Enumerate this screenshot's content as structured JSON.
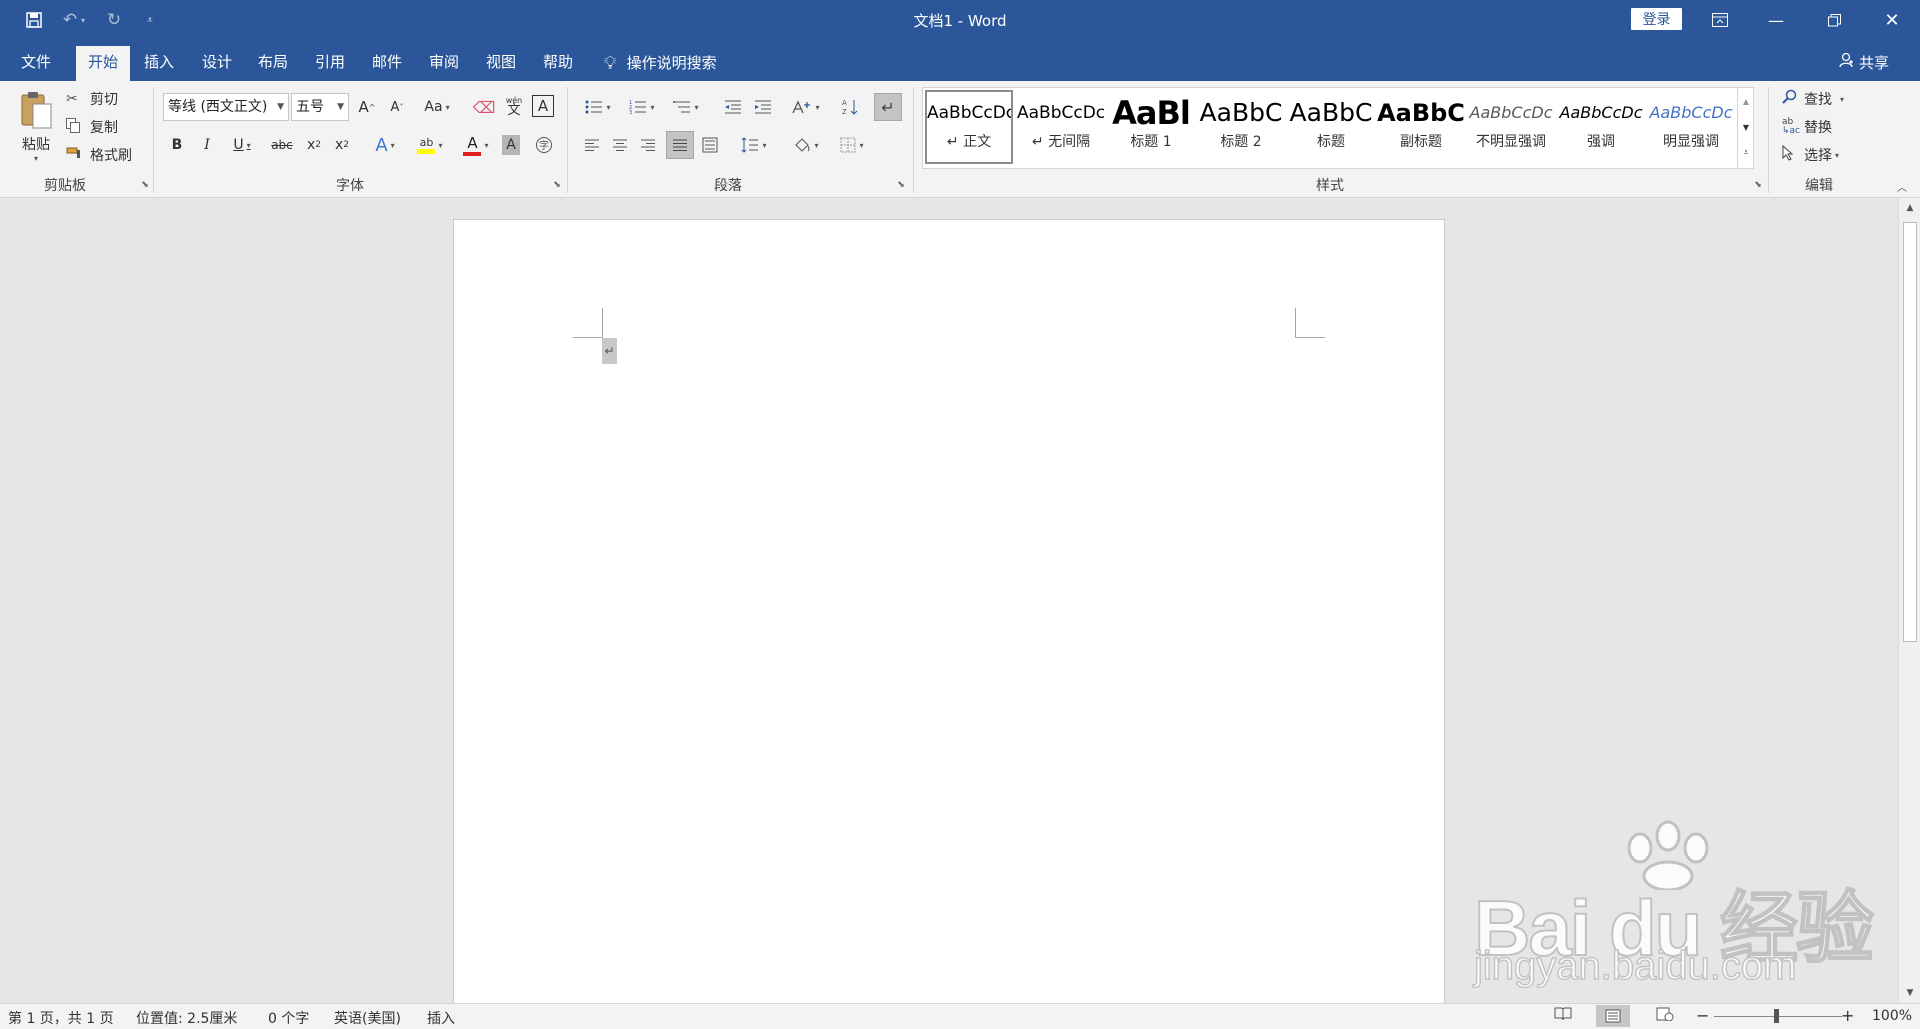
{
  "titlebar": {
    "doc_title": "文档1  -  Word",
    "login_label": "登录",
    "quick_access": [
      "save-icon",
      "undo-icon",
      "redo-icon",
      "customize-icon"
    ]
  },
  "tabs": [
    "文件",
    "开始",
    "插入",
    "设计",
    "布局",
    "引用",
    "邮件",
    "审阅",
    "视图",
    "帮助"
  ],
  "active_tab": "开始",
  "tell_me": "操作说明搜索",
  "share_label": "共享",
  "clipboard": {
    "paste_label": "粘贴",
    "cut_label": "剪切",
    "copy_label": "复制",
    "format_painter_label": "格式刷",
    "group_label": "剪贴板"
  },
  "font": {
    "font_name": "等线 (西文正文)",
    "font_size": "五号",
    "group_label": "字体",
    "bold": "B",
    "italic": "I",
    "underline": "U",
    "strike": "abc",
    "case": "Aa",
    "grow": "A",
    "shrink": "A",
    "char_border": "A",
    "color_red": "#e02020",
    "highlight_yellow": "#ffff00"
  },
  "paragraph": {
    "group_label": "段落"
  },
  "styles": {
    "group_label": "样式",
    "items": [
      {
        "preview": "AaBbCcDc",
        "name": "↵ 正文"
      },
      {
        "preview": "AaBbCcDc",
        "name": "↵ 无间隔"
      },
      {
        "preview": "AaBl",
        "name": "标题 1"
      },
      {
        "preview": "AaBbC",
        "name": "标题 2"
      },
      {
        "preview": "AaBbC",
        "name": "标题"
      },
      {
        "preview": "AaBbC",
        "name": "副标题"
      },
      {
        "preview": "AaBbCcDc",
        "name": "不明显强调"
      },
      {
        "preview": "AaBbCcDc",
        "name": "强调"
      },
      {
        "preview": "AaBbCcDc",
        "name": "明显强调"
      }
    ]
  },
  "editing": {
    "group_label": "编辑",
    "find_label": "查找",
    "replace_label": "替换",
    "select_label": "选择"
  },
  "document": {
    "paragraph_mark": "↵"
  },
  "statusbar": {
    "page": "第 1 页，共 1 页",
    "position": "位置值: 2.5厘米",
    "words": "0 个字",
    "language": "英语(美国)",
    "mode": "插入",
    "zoom": "100%"
  },
  "watermark": {
    "main": "Bai du 经验",
    "url": "jingyan.baidu.com"
  }
}
